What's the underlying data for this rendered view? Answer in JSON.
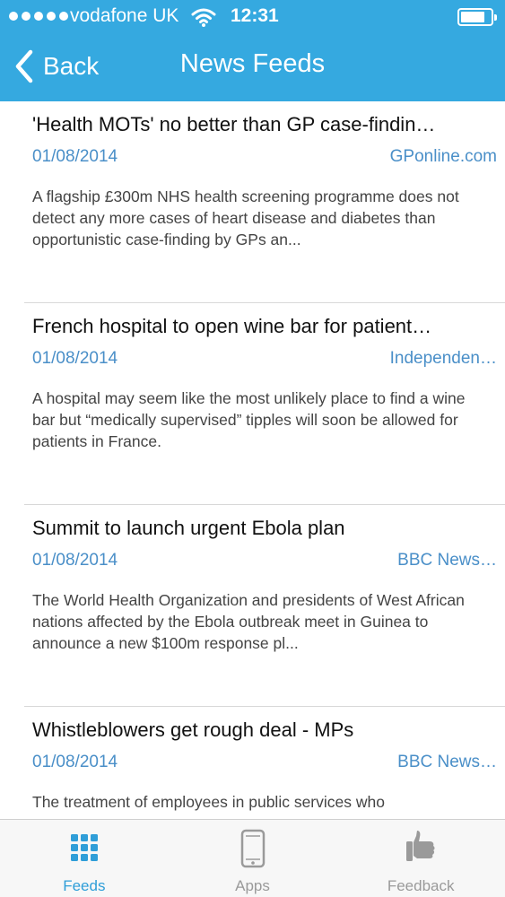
{
  "status_bar": {
    "carrier": "vodafone UK",
    "time": "12:31",
    "battery_level": 0.8
  },
  "nav": {
    "back_label": "Back",
    "title": "News Feeds"
  },
  "feeds": [
    {
      "title": "'Health MOTs' no better than GP case-findin…",
      "date": "01/08/2014",
      "source": "GPonline.com",
      "summary": "A flagship £300m NHS health screening programme does not detect any more cases of heart disease and diabetes than opportunistic case-finding by GPs an..."
    },
    {
      "title": "French hospital to open wine bar for patient…",
      "date": "01/08/2014",
      "source": "Independen…",
      "summary": "A hospital may seem like the most unlikely place to find a wine bar but “medically supervised” tipples will soon be allowed for patients in France."
    },
    {
      "title": "Summit to launch urgent Ebola plan",
      "date": "01/08/2014",
      "source": "BBC News…",
      "summary": "The World Health Organization and presidents of West African nations affected by the Ebola outbreak meet in Guinea to announce a new $100m response pl..."
    },
    {
      "title": "Whistleblowers get rough deal - MPs",
      "date": "01/08/2014",
      "source": "BBC News…",
      "summary": "The treatment of employees in public services who"
    }
  ],
  "tabs": [
    {
      "label": "Feeds",
      "icon": "grid-icon",
      "active": true
    },
    {
      "label": "Apps",
      "icon": "phone-icon",
      "active": false
    },
    {
      "label": "Feedback",
      "icon": "thumbs-up-icon",
      "active": false
    }
  ],
  "colors": {
    "nav_bar": "#35a9e0",
    "accent": "#2f9ed8",
    "meta_text": "#4a8fc8",
    "tab_inactive": "#9a9a9a"
  }
}
